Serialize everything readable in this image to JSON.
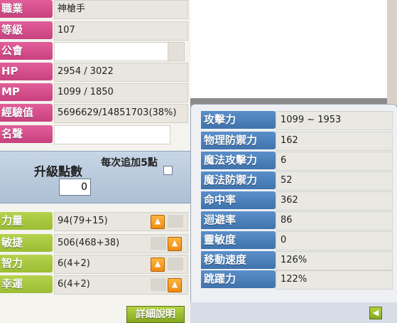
{
  "info": {
    "job": {
      "label": "職業",
      "value": "神槍手"
    },
    "level": {
      "label": "等級",
      "value": "107"
    },
    "guild": {
      "label": "公會",
      "value": ""
    },
    "hp": {
      "label": "HP",
      "value": "2954 / 3022"
    },
    "mp": {
      "label": "MP",
      "value": "1099 / 1850"
    },
    "exp": {
      "label": "經驗值",
      "value": "5696629/14851703(38%)"
    },
    "fame": {
      "label": "名聲",
      "value": ""
    }
  },
  "upgrade": {
    "points_label": "升級點數",
    "points_value": "0",
    "auto_add_label": "每次追加5點",
    "auto_add_checked": false
  },
  "stats": [
    {
      "label": "力量",
      "value": "94(79+15)"
    },
    {
      "label": "敏捷",
      "value": "506(468+38)"
    },
    {
      "label": "智力",
      "value": "6(4+2)"
    },
    {
      "label": "幸運",
      "value": "6(4+2)"
    }
  ],
  "detail_button": "詳細說明",
  "attributes": [
    {
      "label": "攻擊力",
      "value": "1099 ~ 1953"
    },
    {
      "label": "物理防禦力",
      "value": "162"
    },
    {
      "label": "魔法攻擊力",
      "value": "6"
    },
    {
      "label": "魔法防禦力",
      "value": "52"
    },
    {
      "label": "命中率",
      "value": "362"
    },
    {
      "label": "迴避率",
      "value": "86"
    },
    {
      "label": "靈敏度",
      "value": "0"
    },
    {
      "label": "移動速度",
      "value": "126%"
    },
    {
      "label": "跳躍力",
      "value": "122%"
    }
  ],
  "icons": {
    "plus": "plus-icon",
    "collapse": "back-arrow-icon"
  },
  "colors": {
    "info_label": "#d94f8e",
    "stat_label": "#a8c63d",
    "attr_label": "#4a7fbc",
    "button_orange": "#f59a1f"
  }
}
